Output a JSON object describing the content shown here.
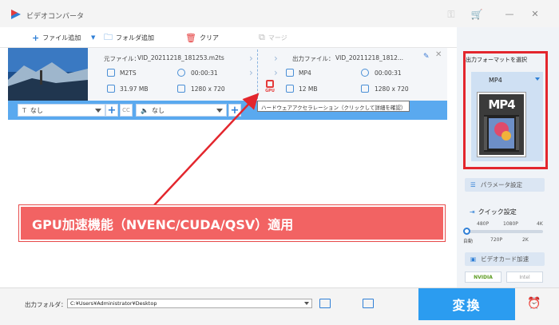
{
  "app": {
    "title": "ビデオコンバータ"
  },
  "toolbar": {
    "add_file": "ファイル追加",
    "add_folder": "フォルダ追加",
    "clear": "クリア",
    "merge": "マージ"
  },
  "file": {
    "source_label": "元ファイル：",
    "source_name": "VID_20211218_181253.m2ts",
    "output_label": "出力ファイル：",
    "output_name": "VID_20211218_1812...",
    "src_format": "M2TS",
    "src_duration": "00:00:31",
    "src_size": "31.97 MB",
    "src_resolution": "1280 x 720",
    "out_format": "MP4",
    "out_duration": "00:00:31",
    "out_size": "12 MB",
    "out_resolution": "1280 x 720",
    "gpu_label": "GPU"
  },
  "options": {
    "subtitle_value": "なし",
    "audio_value": "なし",
    "cc_label": "CC"
  },
  "tooltip": "ハードウェアアクセラレーション（クリックして詳細を確認）",
  "panel": {
    "format_title": "出力フォーマットを選択",
    "format_name": "MP4",
    "card_label": "MP4",
    "param_button": "パラメータ設定",
    "quick_title": "クイック設定",
    "q_480": "480P",
    "q_1080": "1080P",
    "q_4k": "4K",
    "q_auto": "自動",
    "q_720": "720P",
    "q_2k": "2K",
    "quality_position": 0,
    "gpu_accel": "ビデオカード加速",
    "nvidia": "NVIDIA",
    "intel": "Intel"
  },
  "bottom": {
    "output_folder_label": "出力フォルダ：",
    "output_path": "C:¥Users¥Administrator¥Desktop",
    "convert_button": "変換"
  },
  "annotation": {
    "text": "GPU加速機能（NVENC/CUDA/QSV）適用"
  },
  "colors": {
    "accent": "#2b9cf0",
    "highlight_red": "#e3262d",
    "annotation_bg": "#f26363",
    "option_bar": "#5aa9ef"
  }
}
